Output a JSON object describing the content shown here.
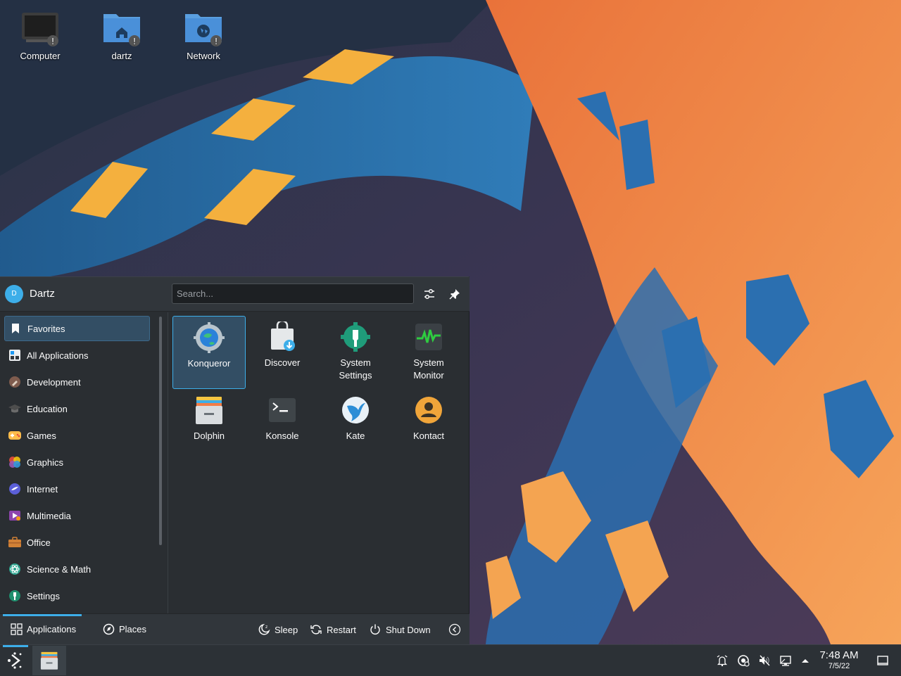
{
  "desktop": {
    "icons": [
      {
        "label": "Computer",
        "icon": "computer-icon"
      },
      {
        "label": "dartz",
        "icon": "home-folder-icon"
      },
      {
        "label": "Network",
        "icon": "network-folder-icon"
      }
    ]
  },
  "launcher": {
    "user": {
      "avatar_letter": "D",
      "name": "Dartz"
    },
    "search": {
      "placeholder": "Search...",
      "value": ""
    },
    "categories": [
      {
        "label": "Favorites",
        "icon": "bookmark-icon",
        "active": true
      },
      {
        "label": "All Applications",
        "icon": "all-apps-icon"
      },
      {
        "label": "Development",
        "icon": "hammer-icon"
      },
      {
        "label": "Education",
        "icon": "graduation-cap-icon"
      },
      {
        "label": "Games",
        "icon": "gamepad-icon"
      },
      {
        "label": "Graphics",
        "icon": "palette-icon"
      },
      {
        "label": "Internet",
        "icon": "globe-icon"
      },
      {
        "label": "Multimedia",
        "icon": "media-icon"
      },
      {
        "label": "Office",
        "icon": "briefcase-icon"
      },
      {
        "label": "Science & Math",
        "icon": "atom-icon"
      },
      {
        "label": "Settings",
        "icon": "settings-icon"
      }
    ],
    "apps": [
      {
        "line1": "Konqueror",
        "line2": "",
        "icon": "konqueror-icon",
        "selected": true
      },
      {
        "line1": "Discover",
        "line2": "",
        "icon": "discover-icon"
      },
      {
        "line1": "System",
        "line2": "Settings",
        "icon": "system-settings-icon"
      },
      {
        "line1": "System",
        "line2": "Monitor",
        "icon": "system-monitor-icon"
      },
      {
        "line1": "Dolphin",
        "line2": "",
        "icon": "dolphin-icon"
      },
      {
        "line1": "Konsole",
        "line2": "",
        "icon": "terminal-icon"
      },
      {
        "line1": "Kate",
        "line2": "",
        "icon": "kate-icon"
      },
      {
        "line1": "Kontact",
        "line2": "",
        "icon": "contact-icon"
      }
    ],
    "footer": {
      "applications": "Applications",
      "places": "Places",
      "sleep": "Sleep",
      "restart": "Restart",
      "shutdown": "Shut Down"
    }
  },
  "taskbar": {
    "clock_time": "7:48 AM",
    "clock_date": "7/5/22"
  },
  "colors": {
    "accent": "#3daee9",
    "panel": "#2a2e32",
    "header": "#31363b",
    "wallpaper_orange": "#f28a3c",
    "wallpaper_blue": "#2d79b8"
  }
}
